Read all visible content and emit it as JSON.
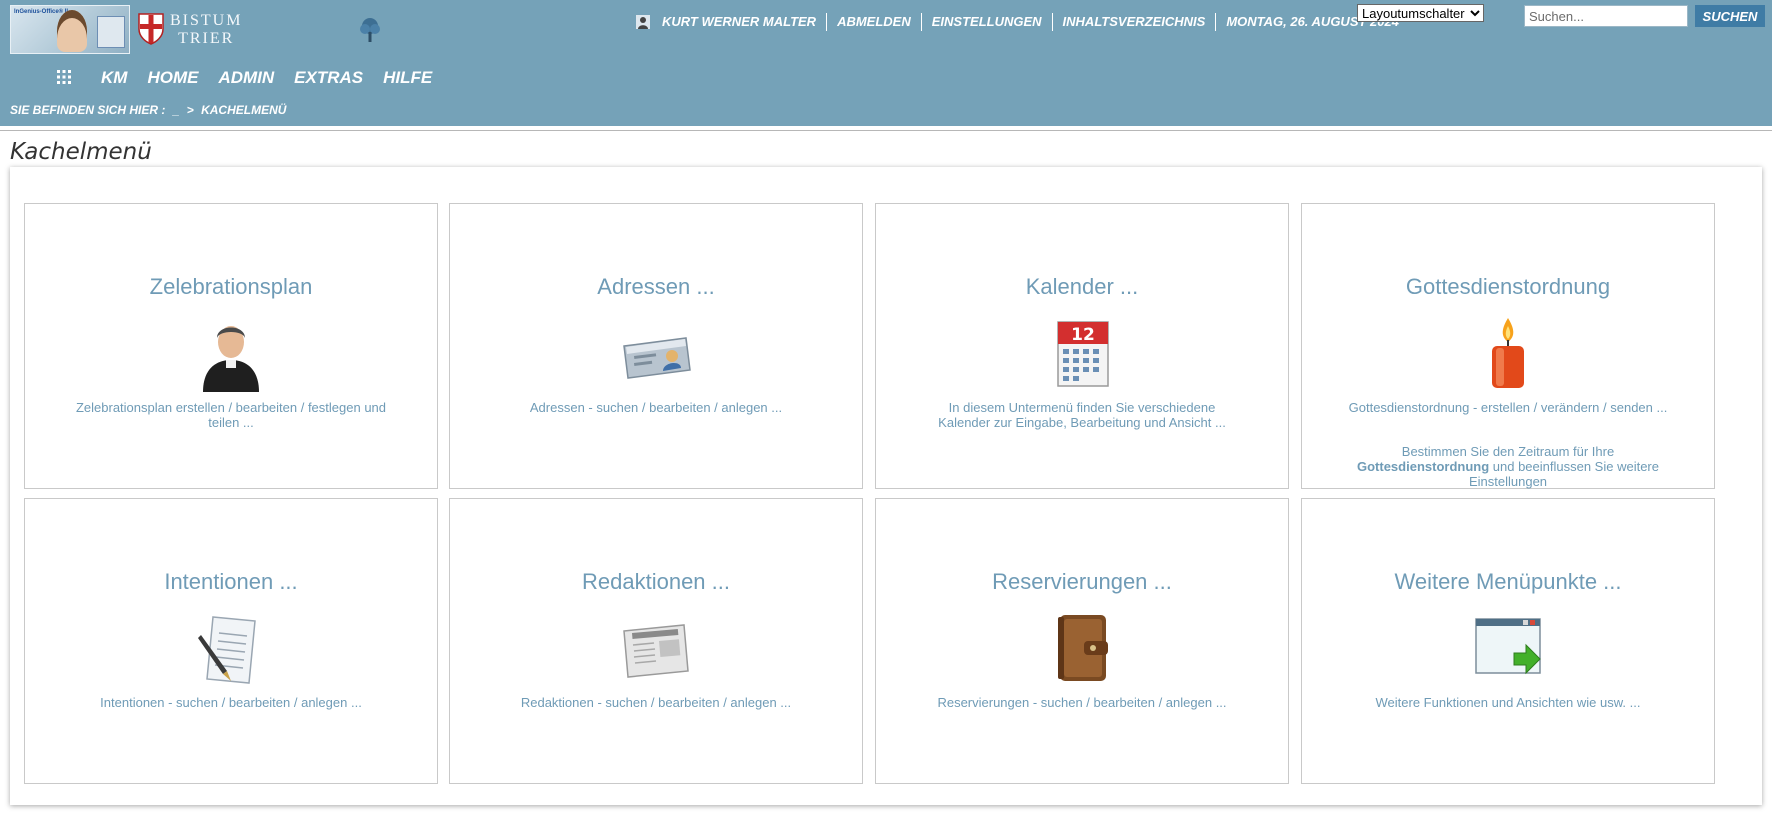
{
  "header": {
    "org_name_line1": "BISTUM",
    "org_name_line2": "TRIER",
    "logo_text": "InGenius-Office® II",
    "top_links": {
      "user": "KURT WERNER MALTER",
      "logout": "ABMELDEN",
      "settings": "EINSTELLUNGEN",
      "index": "INHALTSVERZEICHNIS",
      "date": "MONTAG, 26. AUGUST 2024"
    },
    "layout_select_value": "Layoutumschalter",
    "search": {
      "placeholder": "Suchen...",
      "button": "SUCHEN"
    },
    "nav": [
      "KM",
      "HOME",
      "ADMIN",
      "EXTRAS",
      "HILFE"
    ],
    "breadcrumb": {
      "prefix": "SIE BEFINDEN SICH HIER :",
      "root": "_",
      "separator": ">",
      "current": "KACHELMENÜ"
    }
  },
  "page": {
    "title": "Kachelmenü"
  },
  "tiles": [
    {
      "title": "Zelebrationsplan",
      "icon": "priest-icon",
      "desc": "Zelebrationsplan erstellen / bearbeiten / festlegen und teilen ..."
    },
    {
      "title": "Adressen ...",
      "icon": "id-card-icon",
      "desc": "Adressen - suchen / bearbeiten / anlegen ..."
    },
    {
      "title": "Kalender ...",
      "icon": "calendar-icon",
      "calendar_day": "12",
      "desc": "In diesem Untermenü finden Sie verschiedene Kalender zur Eingabe, Bearbeitung und Ansicht ..."
    },
    {
      "title": "Gottesdienstordnung",
      "icon": "candle-icon",
      "desc": "Gottesdienstordnung - erstellen / verändern / senden ...",
      "extra_before": "Bestimmen Sie den Zeitraum für Ihre ",
      "extra_bold": "Gottesdienstordnung",
      "extra_after": " und beeinflussen Sie weitere Einstellungen"
    },
    {
      "title": "Intentionen ...",
      "icon": "contract-icon",
      "desc": "Intentionen -  suchen / bearbeiten / anlegen ..."
    },
    {
      "title": "Redaktionen ...",
      "icon": "newspaper-icon",
      "desc": "Redaktionen -  suchen / bearbeiten / anlegen ..."
    },
    {
      "title": "Reservierungen ...",
      "icon": "wallet-icon",
      "desc": "Reservierungen -  suchen / bearbeiten / anlegen ..."
    },
    {
      "title": "Weitere Menüpunkte ...",
      "icon": "window-arrow-icon",
      "desc": "Weitere Funktionen und Ansichten wie usw. ..."
    }
  ],
  "colors": {
    "header_bg": "#75a2b8",
    "tile_text": "#6f9bb6",
    "search_button": "#3f7ca5"
  }
}
